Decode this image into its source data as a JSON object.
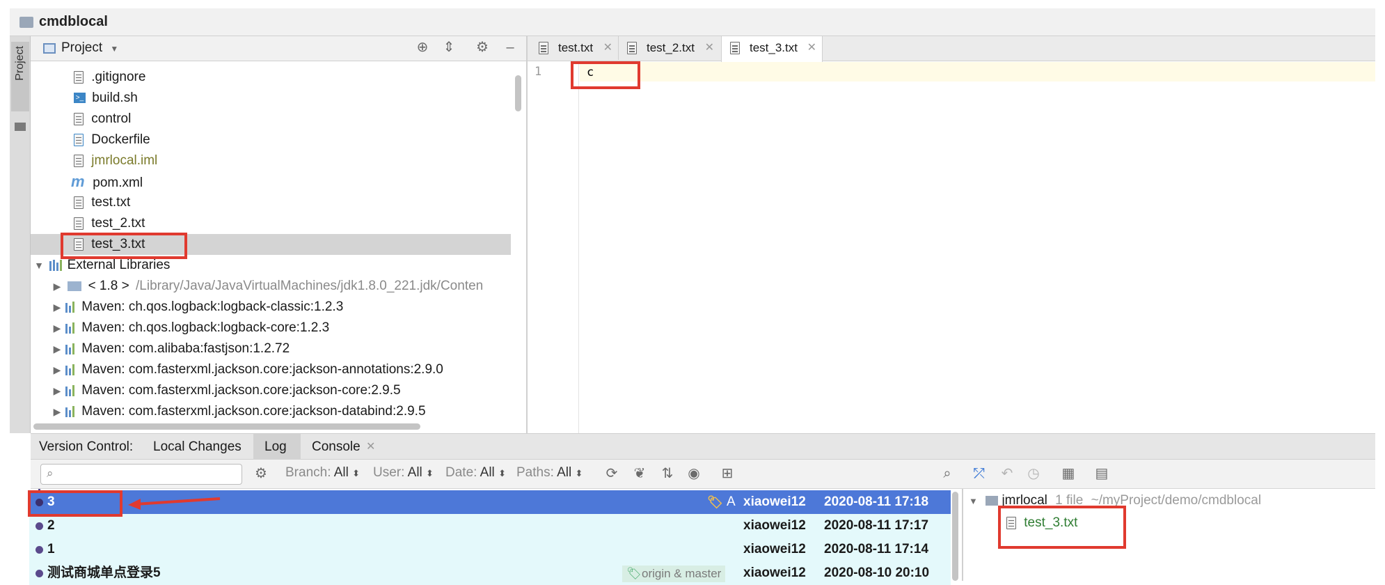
{
  "window": {
    "title": "cmdblocal"
  },
  "side_strip": {
    "label": "Project"
  },
  "project_panel": {
    "title": "Project",
    "tree": [
      {
        "label": ".gitignore",
        "icon": "text-file-icon"
      },
      {
        "label": "build.sh",
        "icon": "shell-script-icon"
      },
      {
        "label": "control",
        "icon": "text-file-icon"
      },
      {
        "label": "Dockerfile",
        "icon": "docker-file-icon"
      },
      {
        "label": "jmrlocal.iml",
        "icon": "module-file-icon"
      },
      {
        "label": "pom.xml",
        "icon": "maven-pom-icon"
      },
      {
        "label": "test.txt",
        "icon": "text-file-icon"
      },
      {
        "label": "test_2.txt",
        "icon": "text-file-icon"
      },
      {
        "label": "test_3.txt",
        "icon": "text-file-icon",
        "selected": true
      }
    ],
    "external_libraries": {
      "label": "External Libraries",
      "items": [
        {
          "prefix": "< 1.8 >",
          "label": "/Library/Java/JavaVirtualMachines/jdk1.8.0_221.jdk/Conten"
        },
        {
          "prefix": "",
          "label": "Maven: ch.qos.logback:logback-classic:1.2.3"
        },
        {
          "prefix": "",
          "label": "Maven: ch.qos.logback:logback-core:1.2.3"
        },
        {
          "prefix": "",
          "label": "Maven: com.alibaba:fastjson:1.2.72"
        },
        {
          "prefix": "",
          "label": "Maven: com.fasterxml.jackson.core:jackson-annotations:2.9.0"
        },
        {
          "prefix": "",
          "label": "Maven: com.fasterxml.jackson.core:jackson-core:2.9.5"
        },
        {
          "prefix": "",
          "label": "Maven: com.fasterxml.jackson.core:jackson-databind:2.9.5"
        }
      ]
    }
  },
  "editor": {
    "tabs": [
      {
        "label": "test.txt",
        "active": false
      },
      {
        "label": "test_2.txt",
        "active": false
      },
      {
        "label": "test_3.txt",
        "active": true
      }
    ],
    "line_number": "1",
    "content": "c"
  },
  "version_control": {
    "label": "Version Control:",
    "tabs": [
      {
        "label": "Local Changes",
        "active": false
      },
      {
        "label": "Log",
        "active": true
      },
      {
        "label": "Console",
        "active": false
      }
    ],
    "search_placeholder": "",
    "filters": [
      {
        "name": "Branch:",
        "value": "All"
      },
      {
        "name": "User:",
        "value": "All"
      },
      {
        "name": "Date:",
        "value": "All"
      },
      {
        "name": "Paths:",
        "value": "All"
      }
    ],
    "commits": [
      {
        "message": "3",
        "tag": "A",
        "user": "xiaowei12",
        "date": "2020-08-11 17:18",
        "selected": true
      },
      {
        "message": "2",
        "tag": "",
        "user": "xiaowei12",
        "date": "2020-08-11 17:17",
        "selected": false
      },
      {
        "message": "1",
        "tag": "",
        "user": "xiaowei12",
        "date": "2020-08-11 17:14",
        "selected": false
      },
      {
        "message": "测试商城单点登录5",
        "tag": "origin & master",
        "user": "xiaowei12",
        "date": "2020-08-10 20:10",
        "selected": false
      }
    ],
    "changes": {
      "module": "jmrlocal",
      "summary": "1 file",
      "path": "~/myProject/demo/cmdblocal",
      "files": [
        "test_3.txt"
      ]
    }
  },
  "colors": {
    "selection_blue": "#4d78d8",
    "commit_row_bg": "#e4f9fb",
    "added_file_green": "#2f7d32",
    "highlight_red": "#e03a2f"
  }
}
